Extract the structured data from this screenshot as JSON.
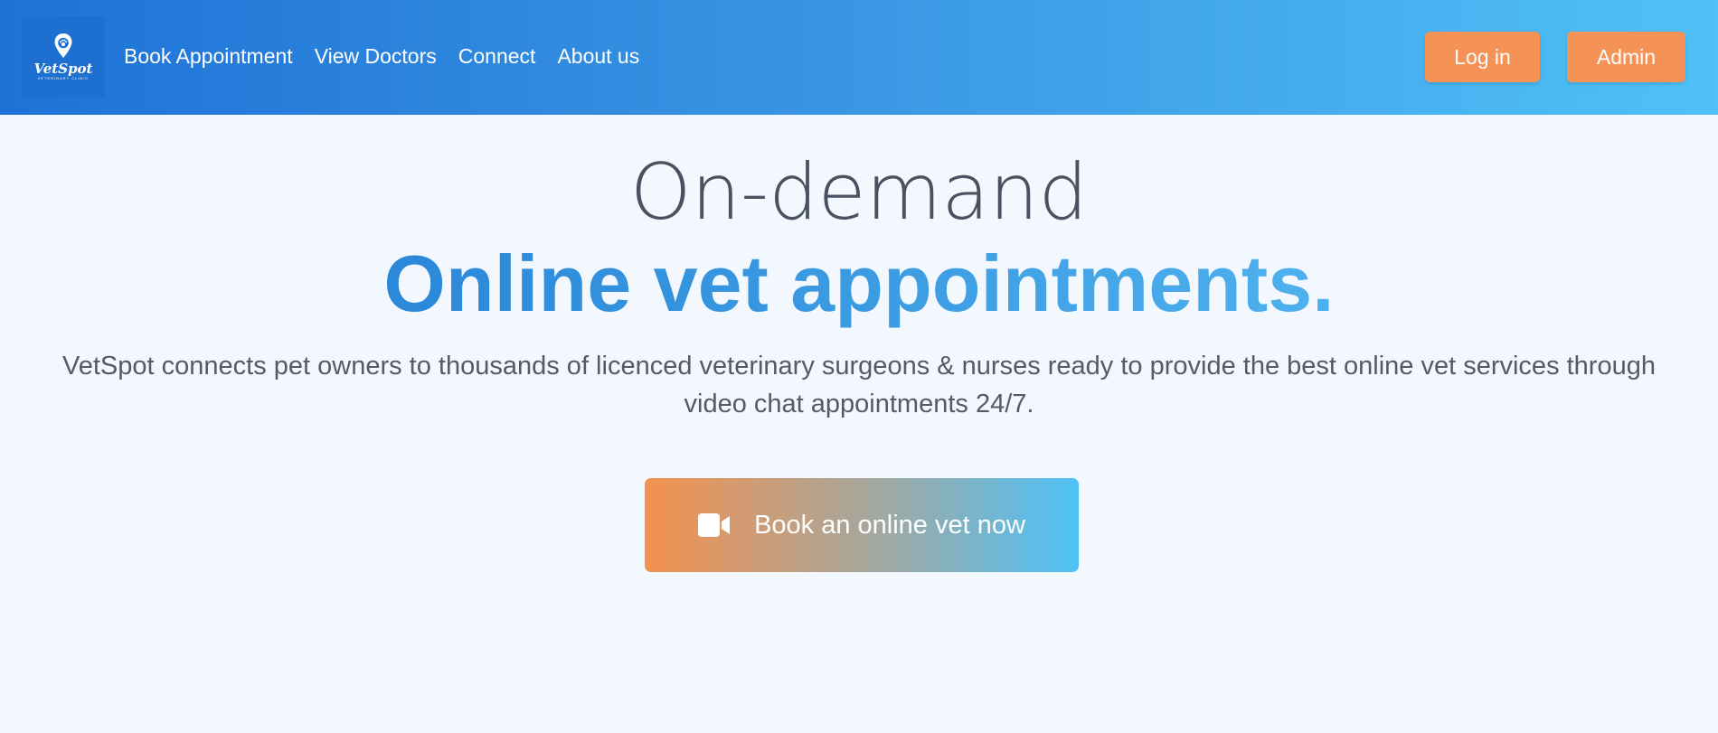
{
  "brand": {
    "name": "VetSpot",
    "tagline": "VETERINARY CLINIC",
    "logo_icon": "map-pin-paw-icon"
  },
  "nav": {
    "links": [
      {
        "label": "Book Appointment"
      },
      {
        "label": "View Doctors"
      },
      {
        "label": "Connect"
      },
      {
        "label": "About us"
      }
    ],
    "login_label": "Log in",
    "admin_label": "Admin"
  },
  "hero": {
    "line1": "On-demand",
    "line2": "Online vet appointments.",
    "description": "VetSpot connects pet owners to thousands of licenced veterinary surgeons & nurses ready to provide the best online vet services through video chat appointments 24/7.",
    "cta_label": "Book an online vet now",
    "cta_icon": "video-camera-icon"
  },
  "colors": {
    "nav_gradient_start": "#1e72d6",
    "nav_gradient_end": "#4fc1f7",
    "accent_orange": "#f49355",
    "headline_blue": "#2b87d8",
    "page_background": "#f3f7fe"
  }
}
